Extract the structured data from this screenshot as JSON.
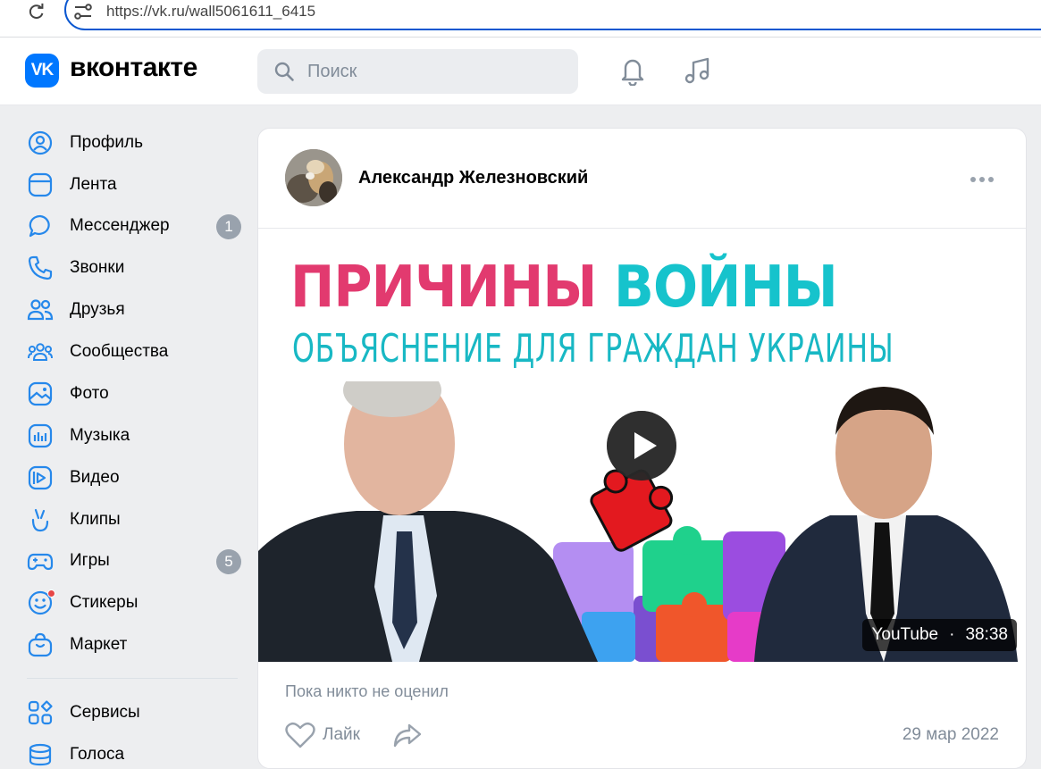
{
  "browser": {
    "url": "https://vk.ru/wall5061611_6415"
  },
  "header": {
    "logo_mark": "VK",
    "logo_text": "вконтакте",
    "search_placeholder": "Поиск"
  },
  "sidebar": {
    "items": [
      {
        "label": "Профиль",
        "icon": "profile-icon"
      },
      {
        "label": "Лента",
        "icon": "feed-icon"
      },
      {
        "label": "Мессенджер",
        "icon": "messenger-icon",
        "badge": "1"
      },
      {
        "label": "Звонки",
        "icon": "phone-icon"
      },
      {
        "label": "Друзья",
        "icon": "friends-icon"
      },
      {
        "label": "Сообщества",
        "icon": "communities-icon"
      },
      {
        "label": "Фото",
        "icon": "photo-icon"
      },
      {
        "label": "Музыка",
        "icon": "music-icon"
      },
      {
        "label": "Видео",
        "icon": "video-icon"
      },
      {
        "label": "Клипы",
        "icon": "clips-icon"
      },
      {
        "label": "Игры",
        "icon": "games-icon",
        "badge": "5"
      },
      {
        "label": "Стикеры",
        "icon": "stickers-icon"
      },
      {
        "label": "Маркет",
        "icon": "market-icon"
      },
      {
        "label": "Сервисы",
        "icon": "services-icon"
      },
      {
        "label": "Голоса",
        "icon": "votes-icon"
      }
    ]
  },
  "post": {
    "author": "Александр Железновский",
    "video": {
      "title_line1_a": "ПРИЧИНЫ",
      "title_line1_b": "ВОЙНЫ",
      "title_line2": "ОБЪЯСНЕНИЕ ДЛЯ ГРАЖДАН УКРАИНЫ",
      "source": "YouTube",
      "separator": "·",
      "duration": "38:38"
    },
    "likes_summary": "Пока никто не оценил",
    "like_label": "Лайк",
    "date": "29 мар 2022"
  },
  "colors": {
    "vk_blue": "#0077ff",
    "title_red": "#e23a6f",
    "title_teal": "#16c3cc",
    "muted": "#818c99",
    "badge": "#99a2ad"
  }
}
